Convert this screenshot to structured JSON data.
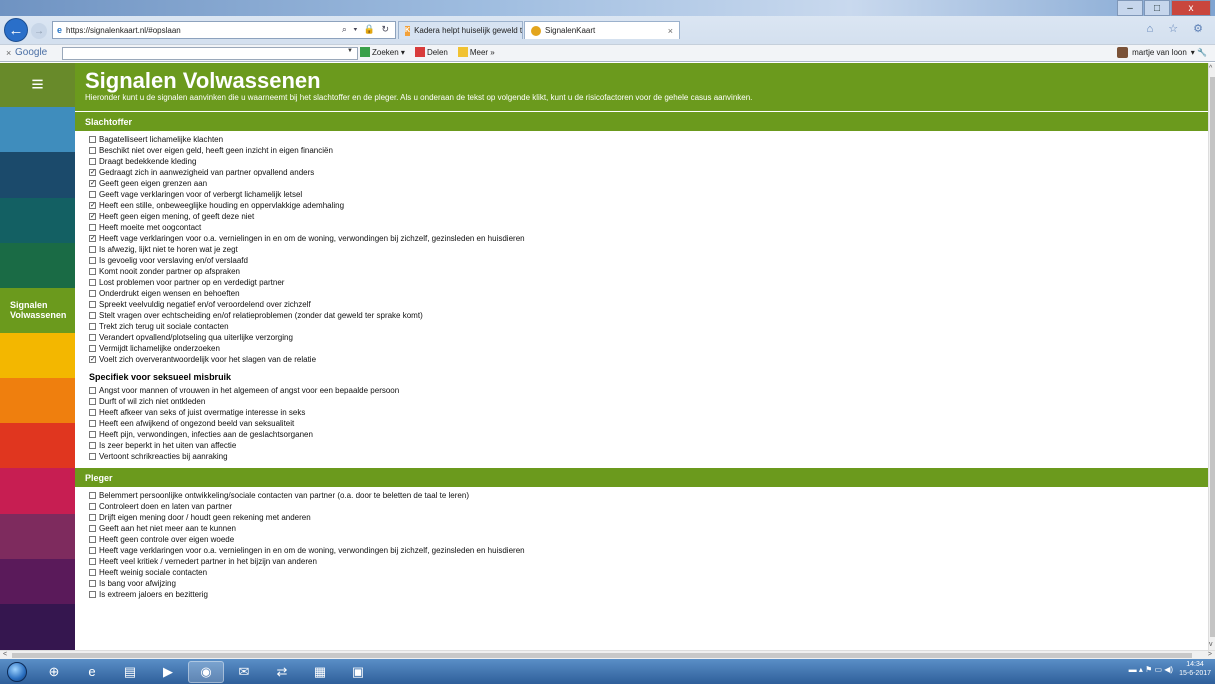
{
  "browser": {
    "url": "https://signalenkaart.nl/#opslaan",
    "address_icons": "⌕ ▾ 🔒 ↻",
    "tabs": [
      {
        "label": "Kadera helpt huiselijk geweld t..."
      },
      {
        "label": "SignalenKaart"
      }
    ],
    "window_buttons": {
      "minimize": "–",
      "maximize": "□",
      "close": "x"
    },
    "right_icons": "⌂ ☆ ⚙"
  },
  "google_toolbar": {
    "close": "×",
    "logo": "Google",
    "search_label": "Zoeken",
    "share_label": "Delen",
    "more_label": "Meer »",
    "user": "martje van loon"
  },
  "sidebar": {
    "menu_icon": "≡",
    "active_label": "Signalen Volwassenen",
    "colors": [
      "#3f8dbd",
      "#1b4a6b",
      "#136063",
      "#1a6b45",
      "#6b9a1d",
      "#f3b700",
      "#ef7f0e",
      "#e0361f",
      "#c71e52",
      "#7e2b5e",
      "#5a1a5a",
      "#35164f"
    ]
  },
  "page": {
    "title": "Signalen Volwassenen",
    "intro": "Hieronder kunt u de signalen aanvinken die u waarneemt bij het slachtoffer en de pleger. Als u onderaan de tekst op volgende klikt, kunt u de risicofactoren voor de gehele casus aanvinken."
  },
  "sections": {
    "slachtoffer": {
      "title": "Slachtoffer",
      "items": [
        {
          "label": "Bagatelliseert lichamelijke klachten",
          "checked": false
        },
        {
          "label": "Beschikt niet over eigen geld, heeft geen inzicht in eigen financiën",
          "checked": false
        },
        {
          "label": "Draagt bedekkende kleding",
          "checked": false
        },
        {
          "label": "Gedraagt zich in aanwezigheid van partner opvallend anders",
          "checked": true
        },
        {
          "label": "Geeft geen eigen grenzen aan",
          "checked": true
        },
        {
          "label": "Geeft vage verklaringen voor of verbergt lichamelijk letsel",
          "checked": false
        },
        {
          "label": "Heeft een stille, onbeweeglijke houding en oppervlakkige ademhaling",
          "checked": true
        },
        {
          "label": "Heeft geen eigen mening, of geeft deze niet",
          "checked": true
        },
        {
          "label": "Heeft moeite met oogcontact",
          "checked": false
        },
        {
          "label": "Heeft vage verklaringen voor o.a. vernielingen in en om de woning, verwondingen bij zichzelf, gezinsleden en huisdieren",
          "checked": true
        },
        {
          "label": "Is afwezig, lijkt niet te horen wat je zegt",
          "checked": false
        },
        {
          "label": "Is gevoelig voor verslaving en/of verslaafd",
          "checked": false
        },
        {
          "label": "Komt nooit zonder partner op afspraken",
          "checked": false
        },
        {
          "label": "Lost problemen voor partner op en verdedigt partner",
          "checked": false
        },
        {
          "label": "Onderdrukt eigen wensen en behoeften",
          "checked": false
        },
        {
          "label": "Spreekt veelvuldig negatief en/of veroordelend over zichzelf",
          "checked": false
        },
        {
          "label": "Stelt vragen over echtscheiding en/of relatieproblemen (zonder dat geweld ter sprake komt)",
          "checked": false
        },
        {
          "label": "Trekt zich terug uit sociale contacten",
          "checked": false
        },
        {
          "label": "Verandert opvallend/plotseling qua uiterlijke verzorging",
          "checked": false
        },
        {
          "label": "Vermijdt lichamelijke onderzoeken",
          "checked": false
        },
        {
          "label": "Voelt zich oververantwoordelijk voor het slagen van de relatie",
          "checked": true
        }
      ]
    },
    "seksueel": {
      "title": "Specifiek voor seksueel misbruik",
      "items": [
        {
          "label": "Angst voor mannen of vrouwen in het algemeen of angst voor een bepaalde persoon",
          "checked": false
        },
        {
          "label": "Durft of wil zich niet ontkleden",
          "checked": false
        },
        {
          "label": "Heeft afkeer van seks of juist overmatige interesse in seks",
          "checked": false
        },
        {
          "label": "Heeft een afwijkend of ongezond beeld van seksualiteit",
          "checked": false
        },
        {
          "label": "Heeft pijn, verwondingen, infecties aan de geslachtsorganen",
          "checked": false
        },
        {
          "label": "Is zeer beperkt in het uiten van affectie",
          "checked": false
        },
        {
          "label": "Vertoont schrikreacties bij aanraking",
          "checked": false
        }
      ]
    },
    "pleger": {
      "title": "Pleger",
      "items": [
        {
          "label": "Belemmert persoonlijke ontwikkeling/sociale contacten van partner (o.a. door te beletten de taal te leren)",
          "checked": false
        },
        {
          "label": "Controleert doen en laten van partner",
          "checked": false
        },
        {
          "label": "Drijft eigen mening door / houdt geen rekening met anderen",
          "checked": false
        },
        {
          "label": "Geeft aan het niet meer aan te kunnen",
          "checked": false
        },
        {
          "label": "Heeft geen controle over eigen woede",
          "checked": false
        },
        {
          "label": "Heeft vage verklaringen voor o.a. vernielingen in en om de woning, verwondingen bij zichzelf, gezinsleden en huisdieren",
          "checked": false
        },
        {
          "label": "Heeft veel kritiek / vernedert partner in het bijzijn van anderen",
          "checked": false
        },
        {
          "label": "Heeft weinig sociale contacten",
          "checked": false
        },
        {
          "label": "Is bang voor afwijzing",
          "checked": false
        },
        {
          "label": "Is extreem jaloers en bezitterig",
          "checked": false
        }
      ]
    }
  },
  "taskbar": {
    "apps": [
      "⊕",
      "e",
      "▤",
      "▶",
      "◉",
      "✉",
      "⇄",
      "▦",
      "▣"
    ],
    "tray_icons": "▬ ▴ ⚑ ▭ ◀)",
    "time": "14:34",
    "date": "15-6-2017"
  }
}
